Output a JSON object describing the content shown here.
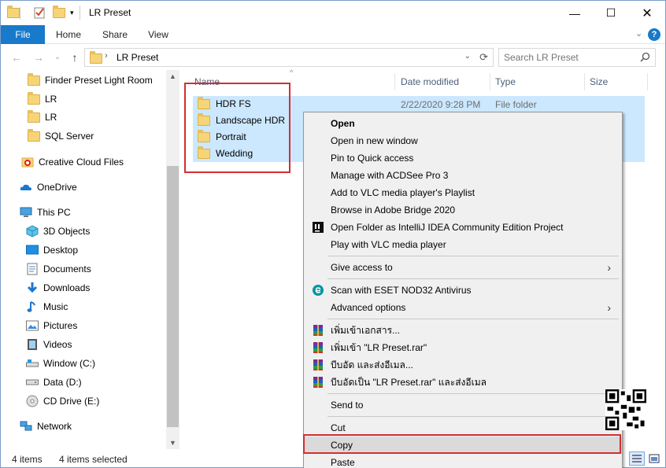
{
  "window": {
    "title": "LR Preset"
  },
  "ribbon": {
    "tabs": [
      "File",
      "Home",
      "Share",
      "View"
    ]
  },
  "address": {
    "path": "LR Preset"
  },
  "search": {
    "placeholder": "Search LR Preset"
  },
  "nav": {
    "items": [
      {
        "label": "Finder Preset Light Room",
        "icon": "folder-icon"
      },
      {
        "label": "LR",
        "icon": "folder-icon"
      },
      {
        "label": "LR",
        "icon": "folder-icon"
      },
      {
        "label": "SQL Server",
        "icon": "folder-icon"
      },
      {
        "label": "Creative Cloud Files",
        "icon": "creative-cloud-icon"
      },
      {
        "label": "OneDrive",
        "icon": "onedrive-icon"
      },
      {
        "label": "This PC",
        "icon": "pc-icon"
      },
      {
        "label": "3D Objects",
        "icon": "3d-objects-icon"
      },
      {
        "label": "Desktop",
        "icon": "desktop-icon"
      },
      {
        "label": "Documents",
        "icon": "documents-icon"
      },
      {
        "label": "Downloads",
        "icon": "downloads-icon"
      },
      {
        "label": "Music",
        "icon": "music-icon"
      },
      {
        "label": "Pictures",
        "icon": "pictures-icon"
      },
      {
        "label": "Videos",
        "icon": "videos-icon"
      },
      {
        "label": "Window (C:)",
        "icon": "drive-c-icon"
      },
      {
        "label": "Data (D:)",
        "icon": "drive-icon"
      },
      {
        "label": "CD Drive (E:)",
        "icon": "cd-drive-icon"
      },
      {
        "label": "Network",
        "icon": "network-icon"
      }
    ]
  },
  "columns": {
    "name": "Name",
    "date": "Date modified",
    "type": "Type",
    "size": "Size"
  },
  "files": [
    {
      "name": "HDR FS",
      "date": "2/22/2020 9:28 PM",
      "type": "File folder"
    },
    {
      "name": "Landscape HDR",
      "date": "",
      "type": ""
    },
    {
      "name": "Portrait",
      "date": "",
      "type": ""
    },
    {
      "name": "Wedding",
      "date": "",
      "type": ""
    }
  ],
  "context_menu": {
    "items": [
      {
        "label": "Open",
        "bold": true
      },
      {
        "label": "Open in new window"
      },
      {
        "label": "Pin to Quick access"
      },
      {
        "label": "Manage with ACDSee Pro 3"
      },
      {
        "label": "Add to VLC media player's Playlist"
      },
      {
        "label": "Browse in Adobe Bridge 2020"
      },
      {
        "label": "Open Folder as IntelliJ IDEA Community Edition Project",
        "icon": "intellij-icon"
      },
      {
        "label": "Play with VLC media player"
      },
      {
        "label": "Give access to",
        "submenu": true
      },
      {
        "label": "Scan with ESET NOD32 Antivirus",
        "icon": "eset-icon"
      },
      {
        "label": "Advanced options",
        "submenu": true
      },
      {
        "label": "เพิ่มเข้าเอกสาร...",
        "icon": "winrar-icon"
      },
      {
        "label": "เพิ่มเข้า \"LR Preset.rar\"",
        "icon": "winrar-icon"
      },
      {
        "label": "บีบอัด และส่งอีเมล...",
        "icon": "winrar-icon"
      },
      {
        "label": "บีบอัดเป็น \"LR Preset.rar\" และส่งอีเมล",
        "icon": "winrar-icon"
      },
      {
        "label": "Send to",
        "submenu": true
      },
      {
        "label": "Cut"
      },
      {
        "label": "Copy",
        "highlighted": true
      },
      {
        "label": "Paste"
      }
    ]
  },
  "status": {
    "count": "4 items",
    "selected": "4 items selected"
  },
  "colors": {
    "accent": "#1979ca",
    "selection": "#cce8ff",
    "highlight_box": "#d32f2f"
  }
}
